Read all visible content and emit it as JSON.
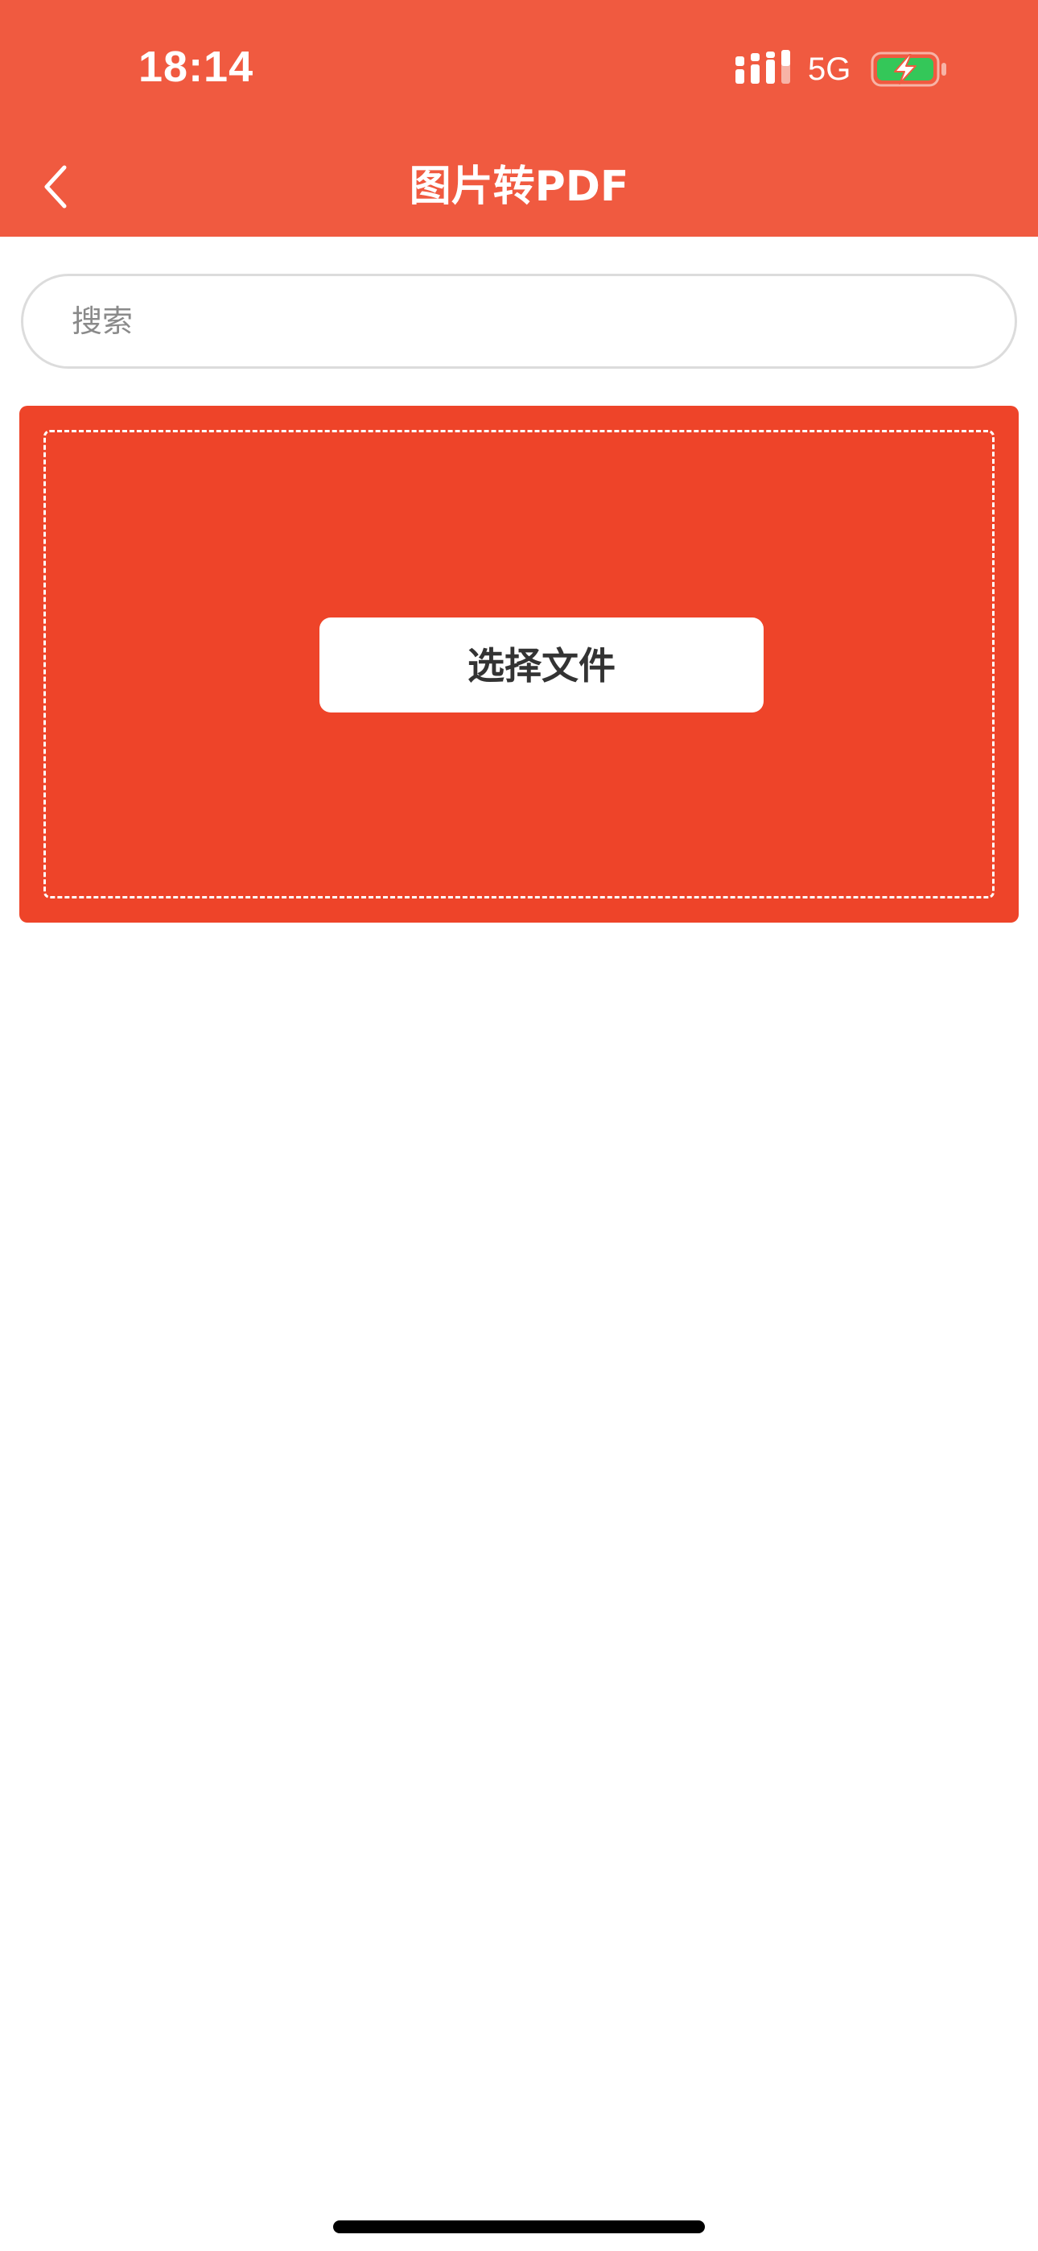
{
  "status_bar": {
    "time": "18:14",
    "network": "5G",
    "signal_icon": "cellular-signal-icon",
    "battery_icon": "battery-charging-icon"
  },
  "nav": {
    "back_icon": "chevron-left-icon",
    "title": "图片转PDF"
  },
  "search": {
    "placeholder": "搜索",
    "value": ""
  },
  "upload": {
    "button_label": "选择文件"
  },
  "colors": {
    "header": "#f05a40",
    "panel": "#ee4429",
    "battery_fill": "#34c759"
  }
}
